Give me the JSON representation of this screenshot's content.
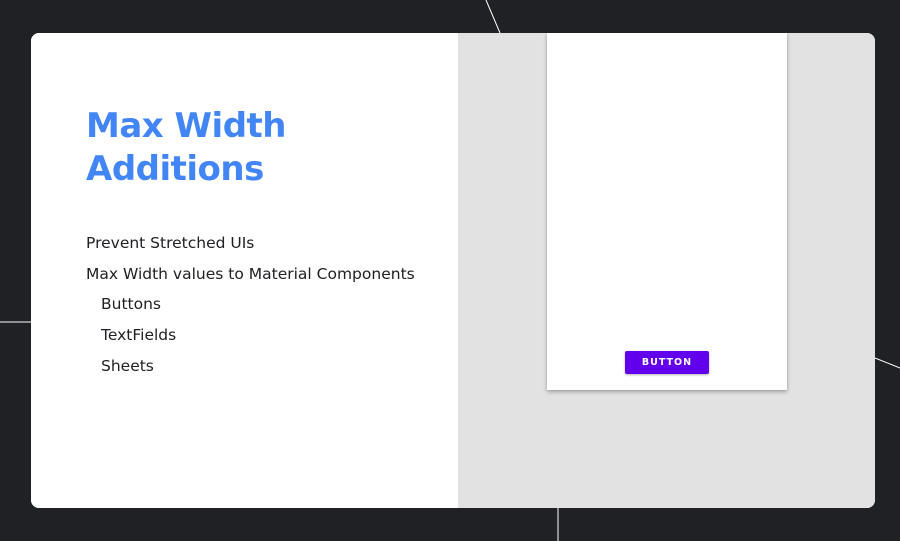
{
  "slide": {
    "title_lines": [
      "Max Width",
      "Additions"
    ],
    "bullets": [
      "Prevent Stretched UIs",
      "Max Width values to Material Components"
    ],
    "sub_bullets": [
      "Buttons",
      "TextFields",
      "Sheets"
    ]
  },
  "phone_preview": {
    "button_label": "BUTTON"
  },
  "colors": {
    "title": "#4285f4",
    "background": "#202124",
    "preview_pane": "#e2e2e2",
    "button": "#6200ee"
  }
}
